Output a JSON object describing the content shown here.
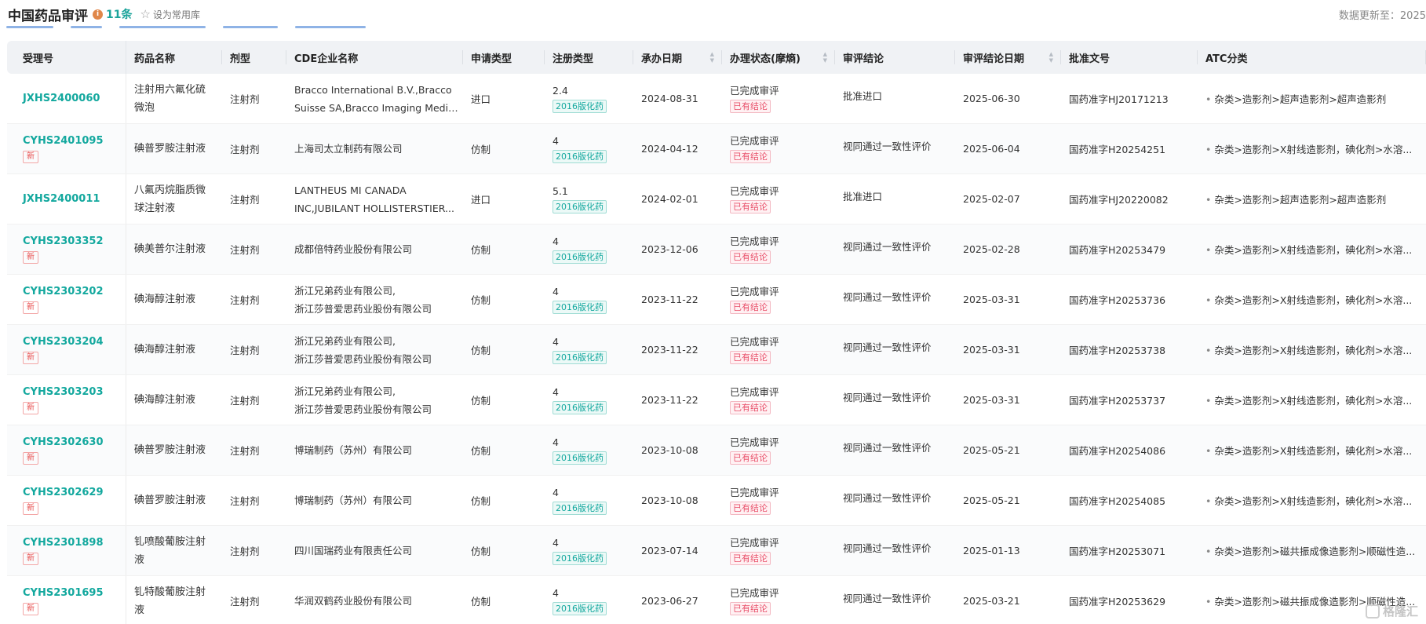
{
  "header": {
    "title": "中国药品审评",
    "info_icon": "i",
    "count": "11条",
    "favorite_label": "设为常用库",
    "update_text": "数据更新至：2025"
  },
  "columns": [
    "受理号",
    "药品名称",
    "剂型",
    "CDE企业名称",
    "申请类型",
    "注册类型",
    "承办日期",
    "办理状态(摩熵)",
    "审评结论",
    "审评结论日期",
    "批准文号",
    "ATC分类"
  ],
  "sortable_columns": [
    "承办日期",
    "办理状态(摩熵)",
    "审评结论日期"
  ],
  "new_badge": "新",
  "rows": [
    {
      "acc": "JXHS2400060",
      "is_new": false,
      "name": [
        "注射用六氟化硫",
        "微泡"
      ],
      "form": "注射剂",
      "ent": [
        "Bracco International B.V.,Bracco",
        "Suisse SA,Bracco Imaging Medical..."
      ],
      "app": "进口",
      "reg_num": "2.4",
      "reg_tag": "2016版化药",
      "date": "2024-08-31",
      "status": "已完成审评",
      "status_tag": "已有结论",
      "concl": "批准进口",
      "concl_date": "2025-06-30",
      "approval": "国药准字HJ20171213",
      "atc": "杂类>造影剂>超声造影剂>超声造影剂"
    },
    {
      "acc": "CYHS2401095",
      "is_new": true,
      "name": [
        "碘普罗胺注射液"
      ],
      "form": "注射剂",
      "ent": [
        "上海司太立制药有限公司"
      ],
      "app": "仿制",
      "reg_num": "4",
      "reg_tag": "2016版化药",
      "date": "2024-04-12",
      "status": "已完成审评",
      "status_tag": "已有结论",
      "concl": "视同通过一致性评价",
      "concl_date": "2025-06-04",
      "approval": "国药准字H20254251",
      "atc": "杂类>造影剂>X射线造影剂，碘化剂>水溶..."
    },
    {
      "acc": "JXHS2400011",
      "is_new": false,
      "name": [
        "八氟丙烷脂质微",
        "球注射液"
      ],
      "form": "注射剂",
      "ent": [
        "LANTHEUS MI CANADA",
        "INC,JUBILANT HOLLISTERSTIER..."
      ],
      "app": "进口",
      "reg_num": "5.1",
      "reg_tag": "2016版化药",
      "date": "2024-02-01",
      "status": "已完成审评",
      "status_tag": "已有结论",
      "concl": "批准进口",
      "concl_date": "2025-02-07",
      "approval": "国药准字HJ20220082",
      "atc": "杂类>造影剂>超声造影剂>超声造影剂"
    },
    {
      "acc": "CYHS2303352",
      "is_new": true,
      "name": [
        "碘美普尔注射液"
      ],
      "form": "注射剂",
      "ent": [
        "成都倍特药业股份有限公司"
      ],
      "app": "仿制",
      "reg_num": "4",
      "reg_tag": "2016版化药",
      "date": "2023-12-06",
      "status": "已完成审评",
      "status_tag": "已有结论",
      "concl": "视同通过一致性评价",
      "concl_date": "2025-02-28",
      "approval": "国药准字H20253479",
      "atc": "杂类>造影剂>X射线造影剂，碘化剂>水溶..."
    },
    {
      "acc": "CYHS2303202",
      "is_new": true,
      "name": [
        "碘海醇注射液"
      ],
      "form": "注射剂",
      "ent": [
        "浙江兄弟药业有限公司,",
        "浙江莎普爱思药业股份有限公司"
      ],
      "app": "仿制",
      "reg_num": "4",
      "reg_tag": "2016版化药",
      "date": "2023-11-22",
      "status": "已完成审评",
      "status_tag": "已有结论",
      "concl": "视同通过一致性评价",
      "concl_date": "2025-03-31",
      "approval": "国药准字H20253736",
      "atc": "杂类>造影剂>X射线造影剂，碘化剂>水溶..."
    },
    {
      "acc": "CYHS2303204",
      "is_new": true,
      "name": [
        "碘海醇注射液"
      ],
      "form": "注射剂",
      "ent": [
        "浙江兄弟药业有限公司,",
        "浙江莎普爱思药业股份有限公司"
      ],
      "app": "仿制",
      "reg_num": "4",
      "reg_tag": "2016版化药",
      "date": "2023-11-22",
      "status": "已完成审评",
      "status_tag": "已有结论",
      "concl": "视同通过一致性评价",
      "concl_date": "2025-03-31",
      "approval": "国药准字H20253738",
      "atc": "杂类>造影剂>X射线造影剂，碘化剂>水溶..."
    },
    {
      "acc": "CYHS2303203",
      "is_new": true,
      "name": [
        "碘海醇注射液"
      ],
      "form": "注射剂",
      "ent": [
        "浙江兄弟药业有限公司,",
        "浙江莎普爱思药业股份有限公司"
      ],
      "app": "仿制",
      "reg_num": "4",
      "reg_tag": "2016版化药",
      "date": "2023-11-22",
      "status": "已完成审评",
      "status_tag": "已有结论",
      "concl": "视同通过一致性评价",
      "concl_date": "2025-03-31",
      "approval": "国药准字H20253737",
      "atc": "杂类>造影剂>X射线造影剂，碘化剂>水溶..."
    },
    {
      "acc": "CYHS2302630",
      "is_new": true,
      "name": [
        "碘普罗胺注射液"
      ],
      "form": "注射剂",
      "ent": [
        "博瑞制药（苏州）有限公司"
      ],
      "app": "仿制",
      "reg_num": "4",
      "reg_tag": "2016版化药",
      "date": "2023-10-08",
      "status": "已完成审评",
      "status_tag": "已有结论",
      "concl": "视同通过一致性评价",
      "concl_date": "2025-05-21",
      "approval": "国药准字H20254086",
      "atc": "杂类>造影剂>X射线造影剂，碘化剂>水溶..."
    },
    {
      "acc": "CYHS2302629",
      "is_new": true,
      "name": [
        "碘普罗胺注射液"
      ],
      "form": "注射剂",
      "ent": [
        "博瑞制药（苏州）有限公司"
      ],
      "app": "仿制",
      "reg_num": "4",
      "reg_tag": "2016版化药",
      "date": "2023-10-08",
      "status": "已完成审评",
      "status_tag": "已有结论",
      "concl": "视同通过一致性评价",
      "concl_date": "2025-05-21",
      "approval": "国药准字H20254085",
      "atc": "杂类>造影剂>X射线造影剂，碘化剂>水溶..."
    },
    {
      "acc": "CYHS2301898",
      "is_new": true,
      "name": [
        "钆喷酸葡胺注射",
        "液"
      ],
      "form": "注射剂",
      "ent": [
        "四川国瑞药业有限责任公司"
      ],
      "app": "仿制",
      "reg_num": "4",
      "reg_tag": "2016版化药",
      "date": "2023-07-14",
      "status": "已完成审评",
      "status_tag": "已有结论",
      "concl": "视同通过一致性评价",
      "concl_date": "2025-01-13",
      "approval": "国药准字H20253071",
      "atc": "杂类>造影剂>磁共振成像造影剂>顺磁性造..."
    },
    {
      "acc": "CYHS2301695",
      "is_new": true,
      "name": [
        "钆特酸葡胺注射",
        "液"
      ],
      "form": "注射剂",
      "ent": [
        "华润双鹤药业股份有限公司"
      ],
      "app": "仿制",
      "reg_num": "4",
      "reg_tag": "2016版化药",
      "date": "2023-06-27",
      "status": "已完成审评",
      "status_tag": "已有结论",
      "concl": "视同通过一致性评价",
      "concl_date": "2025-03-21",
      "approval": "国药准字H20253629",
      "atc": "杂类>造影剂>磁共振成像造影剂>顺磁性造..."
    }
  ],
  "watermark": "格隆汇",
  "colors": {
    "accent": "#13a89e",
    "new_red": "#e84c4c",
    "tag_red": "#e8506a",
    "header_bg": "#f0f2f5"
  }
}
